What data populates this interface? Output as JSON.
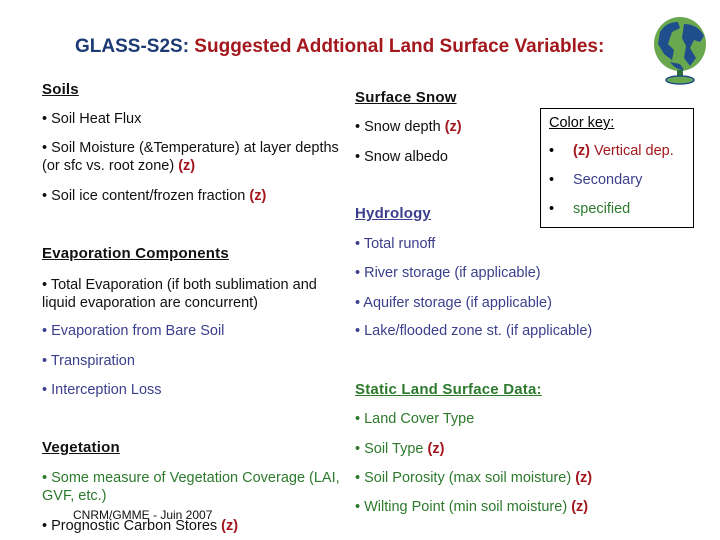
{
  "title": {
    "prefix": "GLASS-S2S:",
    "main": " Suggested Addtional Land Surface Variables:"
  },
  "colors": {
    "title_blue": "#1c3a73",
    "vertical_dep_red": "#a3171d",
    "secondary": "#3b3f8c",
    "specified": "#2d7a2d"
  },
  "soils": {
    "heading": "Soils",
    "items": [
      {
        "text": "• Soil Heat Flux"
      },
      {
        "text": "• Soil Moisture (&Temperature) at layer depths (or sfc vs. root zone) ",
        "z": "(z)"
      },
      {
        "text": "• Soil ice content/frozen fraction ",
        "z": "(z)"
      }
    ]
  },
  "surface_snow": {
    "heading": "Surface Snow",
    "items": [
      {
        "text": "• Snow depth ",
        "z": "(z)"
      },
      {
        "text": "• Snow albedo"
      }
    ]
  },
  "color_key": {
    "title": "Color key:",
    "rows": [
      {
        "bullet": "•",
        "z": "(z)",
        "label": " Vertical dep."
      },
      {
        "bullet": "•",
        "label": "Secondary"
      },
      {
        "bullet": "•",
        "label": "specified"
      }
    ]
  },
  "hydrology": {
    "heading": "Hydrology",
    "items": [
      {
        "text": "• Total runoff"
      },
      {
        "text": "• River storage (if applicable)"
      },
      {
        "text": "• Aquifer storage (if applicable)"
      },
      {
        "text": "• Lake/flooded zone st. (if applicable)"
      }
    ]
  },
  "evaporation": {
    "heading": "Evaporation Components",
    "items": [
      {
        "text": "• Total Evaporation (if both sublimation and liquid evaporation are concurrent)"
      },
      {
        "text": "• Evaporation from Bare Soil"
      },
      {
        "text": "• Transpiration"
      },
      {
        "text": "• Interception Loss"
      }
    ]
  },
  "static": {
    "heading": "Static Land Surface Data:",
    "items": [
      {
        "text": "• Land Cover Type"
      },
      {
        "text": "• Soil Type ",
        "z": "(z)"
      },
      {
        "text": "• Soil Porosity (max soil moisture) ",
        "z": "(z)"
      },
      {
        "text": "• Wilting Point (min soil moisture) ",
        "z": "(z)"
      }
    ]
  },
  "vegetation": {
    "heading": "Vegetation",
    "items": [
      {
        "text": "• Some measure of Vegetation Coverage (LAI, GVF, etc.)"
      },
      {
        "text": "• Prognostic Carbon Stores ",
        "z": "(z)"
      }
    ]
  },
  "footer": "CNRM/GMME - Juin 2007",
  "logo_icon": "globe-icon"
}
